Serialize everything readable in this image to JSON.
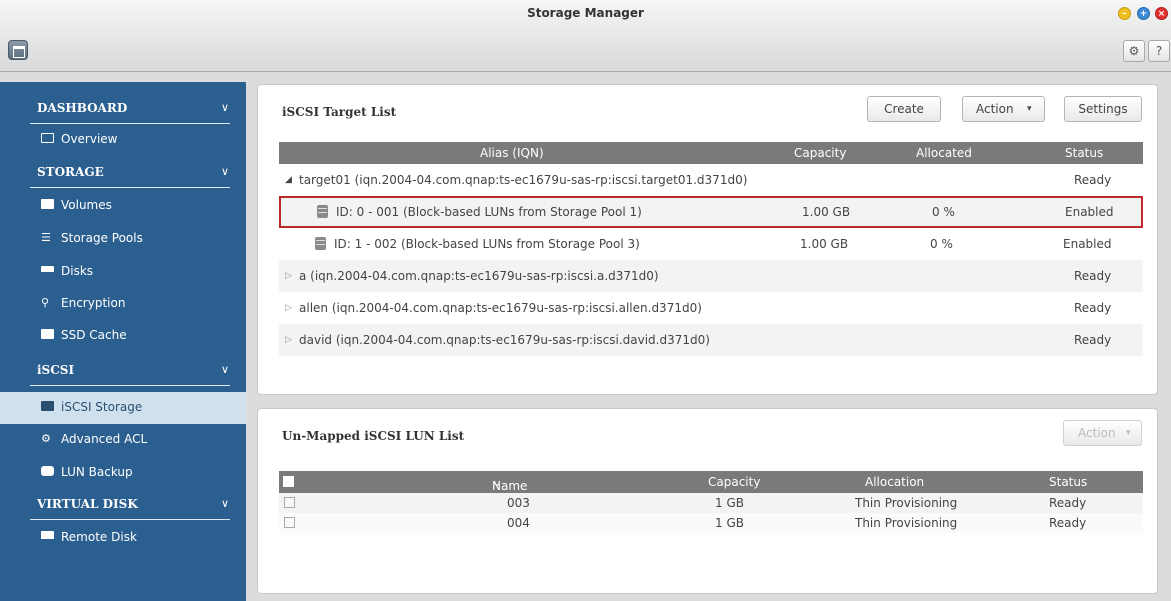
{
  "window": {
    "title": "Storage Manager"
  },
  "toolbar": {
    "settings_icon": "gear-icon",
    "help_label": "?"
  },
  "sidebar": {
    "sections": [
      {
        "label": "DASHBOARD",
        "items": [
          {
            "label": "Overview",
            "icon": "overview-icon"
          }
        ]
      },
      {
        "label": "STORAGE",
        "items": [
          {
            "label": "Volumes",
            "icon": "volume-icon"
          },
          {
            "label": "Storage Pools",
            "icon": "storage-pool-icon"
          },
          {
            "label": "Disks",
            "icon": "disk-icon"
          },
          {
            "label": "Encryption",
            "icon": "key-icon"
          },
          {
            "label": "SSD Cache",
            "icon": "ssd-icon"
          }
        ]
      },
      {
        "label": "iSCSI",
        "items": [
          {
            "label": "iSCSI Storage",
            "icon": "iscsi-icon",
            "active": true
          },
          {
            "label": "Advanced ACL",
            "icon": "gear-icon"
          },
          {
            "label": "LUN Backup",
            "icon": "backup-icon"
          }
        ]
      },
      {
        "label": "VIRTUAL DISK",
        "items": [
          {
            "label": "Remote Disk",
            "icon": "remote-disk-icon"
          }
        ]
      }
    ]
  },
  "target_list": {
    "title": "iSCSI Target List",
    "buttons": {
      "create": "Create",
      "action": "Action",
      "settings": "Settings"
    },
    "columns": [
      "Alias (IQN)",
      "Capacity",
      "Allocated",
      "Status"
    ],
    "rows": [
      {
        "label": "target01 (iqn.2004-04.com.qnap:ts-ec1679u-sas-rp:iscsi.target01.d371d0)",
        "capacity": "",
        "allocated": "",
        "status": "Ready",
        "expanded": true
      },
      {
        "label": "ID: 0 - 001 (Block-based LUNs from Storage Pool 1)",
        "capacity": "1.00 GB",
        "allocated": "0 %",
        "status": "Enabled",
        "child": true,
        "highlight": true
      },
      {
        "label": "ID: 1 - 002 (Block-based LUNs from Storage Pool 3)",
        "capacity": "1.00 GB",
        "allocated": "0 %",
        "status": "Enabled",
        "child": true
      },
      {
        "label": "a (iqn.2004-04.com.qnap:ts-ec1679u-sas-rp:iscsi.a.d371d0)",
        "capacity": "",
        "allocated": "",
        "status": "Ready"
      },
      {
        "label": "allen (iqn.2004-04.com.qnap:ts-ec1679u-sas-rp:iscsi.allen.d371d0)",
        "capacity": "",
        "allocated": "",
        "status": "Ready"
      },
      {
        "label": "david (iqn.2004-04.com.qnap:ts-ec1679u-sas-rp:iscsi.david.d371d0)",
        "capacity": "",
        "allocated": "",
        "status": "Ready"
      }
    ]
  },
  "unmapped_list": {
    "title": "Un-Mapped iSCSI LUN List",
    "action_label": "Action",
    "columns": [
      "Name",
      "Capacity",
      "Allocation",
      "Status"
    ],
    "rows": [
      {
        "name": "003",
        "capacity": "1 GB",
        "allocation": "Thin Provisioning",
        "status": "Ready"
      },
      {
        "name": "004",
        "capacity": "1 GB",
        "allocation": "Thin Provisioning",
        "status": "Ready"
      }
    ]
  },
  "colors": {
    "sidebar": "#2b5f8f",
    "active_item": "#cfe1ef",
    "highlight_border": "#c0292b",
    "table_header": "#7a7a7a"
  }
}
